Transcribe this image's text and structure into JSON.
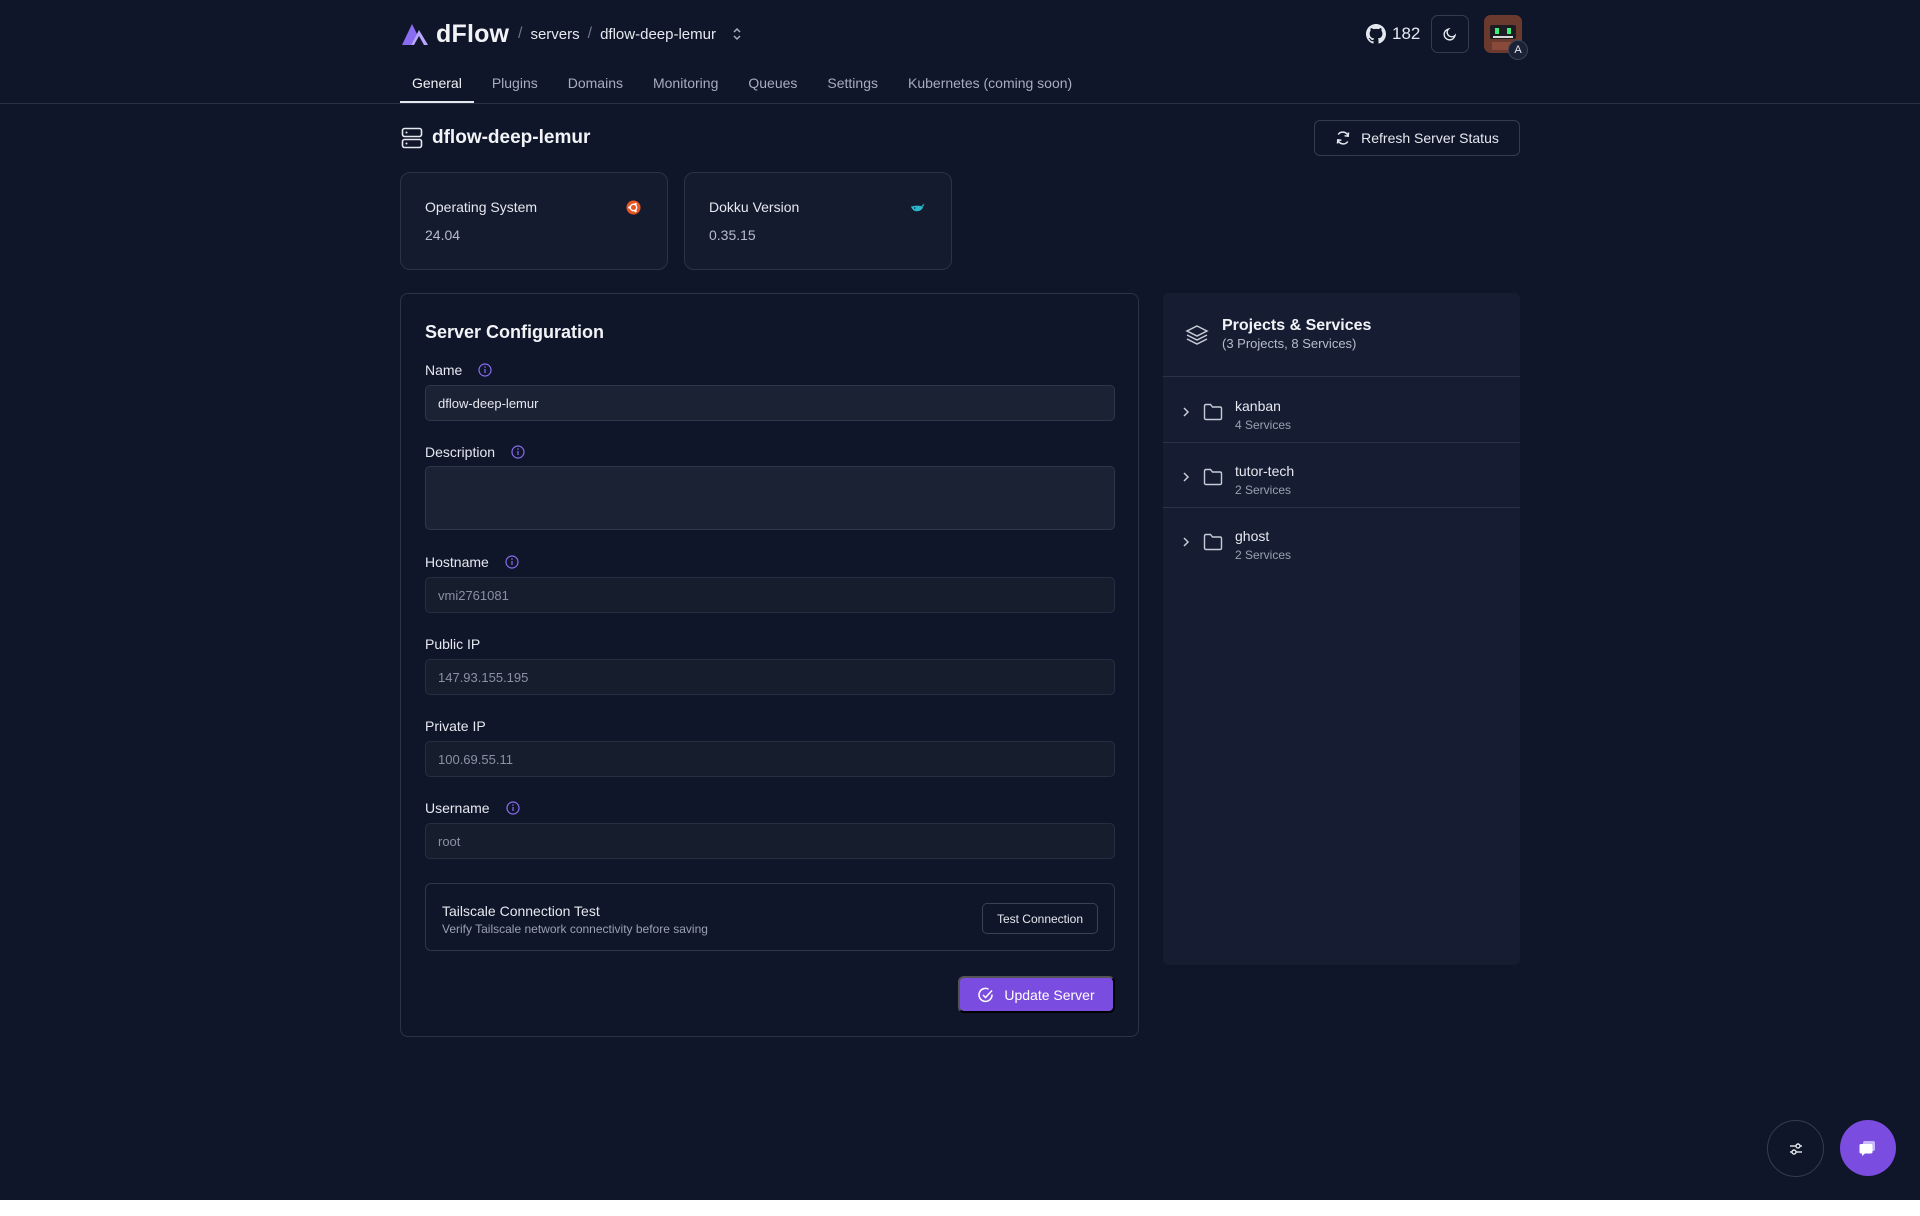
{
  "app": {
    "brand": "dFlow",
    "breadcrumb": {
      "section": "servers",
      "current": "dflow-deep-lemur"
    },
    "github_stars": "182",
    "avatar_badge": "A"
  },
  "tabs": [
    {
      "label": "General",
      "active": true
    },
    {
      "label": "Plugins",
      "active": false
    },
    {
      "label": "Domains",
      "active": false
    },
    {
      "label": "Monitoring",
      "active": false
    },
    {
      "label": "Queues",
      "active": false
    },
    {
      "label": "Settings",
      "active": false
    },
    {
      "label": "Kubernetes (coming soon)",
      "active": false
    }
  ],
  "page": {
    "title": "dflow-deep-lemur",
    "refresh_label": "Refresh Server Status"
  },
  "cards": {
    "os": {
      "label": "Operating System",
      "value": "24.04",
      "icon": "ubuntu-icon",
      "icon_color": "#e95420"
    },
    "dokku": {
      "label": "Dokku Version",
      "value": "0.35.15",
      "icon": "dokku-whale-icon",
      "icon_color": "#2ab7ca"
    }
  },
  "config": {
    "heading": "Server Configuration",
    "name": {
      "label": "Name",
      "value": "dflow-deep-lemur"
    },
    "description": {
      "label": "Description",
      "value": ""
    },
    "hostname": {
      "label": "Hostname",
      "value": "vmi2761081"
    },
    "public_ip": {
      "label": "Public IP",
      "value": "147.93.155.195"
    },
    "private_ip": {
      "label": "Private IP",
      "value": "100.69.55.11"
    },
    "username": {
      "label": "Username",
      "value": "root"
    },
    "tailscale": {
      "title": "Tailscale Connection Test",
      "subtitle": "Verify Tailscale network connectivity before saving",
      "button": "Test Connection"
    },
    "submit_label": "Update Server"
  },
  "projects": {
    "title": "Projects & Services",
    "subtitle": "(3 Projects, 8 Services)",
    "items": [
      {
        "name": "kanban",
        "count": "4 Services"
      },
      {
        "name": "tutor-tech",
        "count": "2 Services"
      },
      {
        "name": "ghost",
        "count": "2 Services"
      }
    ]
  },
  "colors": {
    "accent": "#7b4ce0",
    "background": "#0f1629",
    "info_icon": "#8b6cf0"
  }
}
